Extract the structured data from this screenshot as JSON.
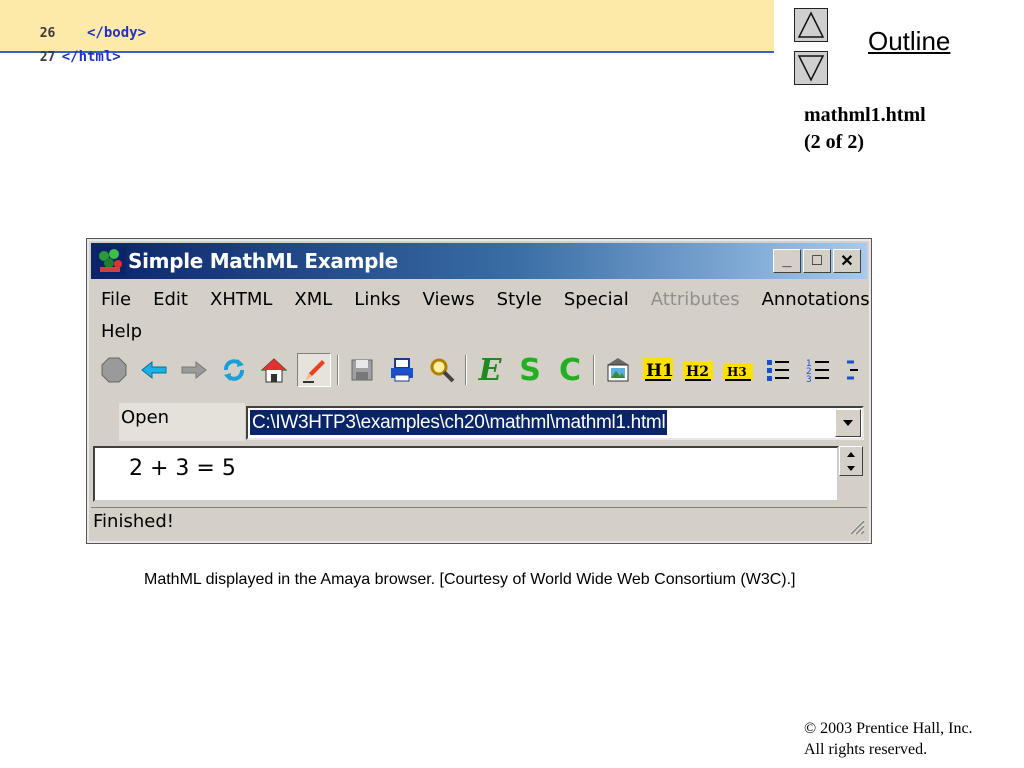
{
  "code": {
    "lines": [
      {
        "number": "26",
        "text": "   </body>"
      },
      {
        "number": "27",
        "text": "</html>"
      }
    ]
  },
  "nav": {
    "outline": "Outline",
    "file": "mathml1.html",
    "page": "(2 of 2)"
  },
  "window": {
    "title": "Simple MathML Example",
    "controls": {
      "minimize": "_",
      "maximize": "□",
      "close": "✕"
    },
    "menu_row1": [
      "File",
      "Edit",
      "XHTML",
      "XML",
      "Links",
      "Views",
      "Style",
      "Special",
      "Attributes",
      "Annotations"
    ],
    "menu_row2": [
      "Help"
    ],
    "disabled_menu": "Attributes",
    "toolbar_letters": {
      "e": "E",
      "s": "S",
      "c": "C"
    },
    "open_label": "Open",
    "address": "C:\\IW3HTP3\\examples\\ch20\\mathml\\mathml1.html",
    "math_content": "2 + 3 = 5",
    "status": "Finished!"
  },
  "caption": "MathML displayed in the Amaya browser. [Courtesy of World Wide Web Consortium (W3C).]",
  "copyright": {
    "line1": "© 2003 Prentice Hall, Inc.",
    "line2": "All rights reserved."
  },
  "colors": {
    "code_background": "#fde9a8",
    "code_text": "#2030c8",
    "titlebar_start": "#0a246a",
    "titlebar_end": "#a6caf0",
    "window_face": "#d4d0c8"
  },
  "icons": [
    "stop-icon",
    "back-arrow-icon",
    "forward-arrow-icon",
    "reload-icon",
    "home-icon",
    "edit-pencil-icon",
    "save-icon",
    "print-icon",
    "find-icon",
    "e-icon",
    "s-icon",
    "c-icon",
    "image-icon",
    "h1-icon",
    "h2-icon",
    "h3-icon",
    "bullet-list-icon",
    "numbered-list-icon",
    "definition-list-icon"
  ]
}
